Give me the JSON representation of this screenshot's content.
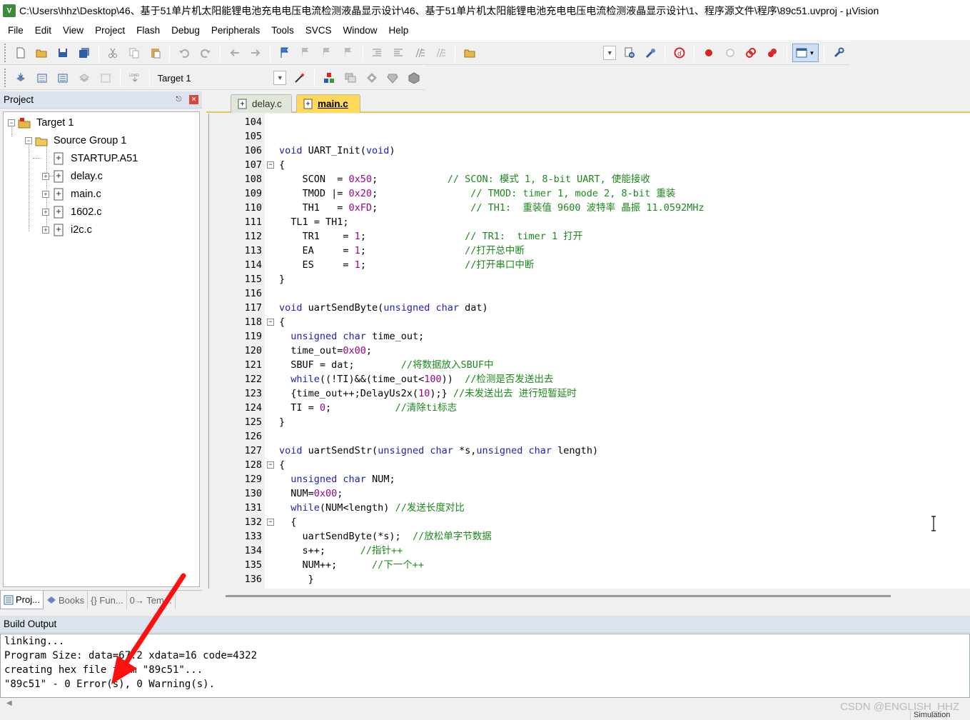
{
  "window": {
    "title": "C:\\Users\\hhz\\Desktop\\46、基于51单片机太阳能锂电池充电电压电流检测液晶显示设计\\46、基于51单片机太阳能锂电池充电电压电流检测液晶显示设计\\1、程序源文件\\程序\\89c51.uvproj - µVision",
    "logo": "V"
  },
  "menu": [
    "File",
    "Edit",
    "View",
    "Project",
    "Flash",
    "Debug",
    "Peripherals",
    "Tools",
    "SVCS",
    "Window",
    "Help"
  ],
  "toolbar2": {
    "target": "Target 1"
  },
  "project_panel": {
    "title": "Project",
    "tree": {
      "target": "Target 1",
      "group": "Source Group 1",
      "files": [
        "STARTUP.A51",
        "delay.c",
        "main.c",
        "1602.c",
        "i2c.c"
      ]
    },
    "bottom_tabs": [
      "Proj...",
      "Books",
      "{} Fun...",
      "0→ Tem..."
    ]
  },
  "editor": {
    "tabs": [
      "delay.c",
      "main.c"
    ],
    "active_tab": "main.c",
    "lines": [
      {
        "n": "104",
        "html": ""
      },
      {
        "n": "105",
        "html": ""
      },
      {
        "n": "106",
        "html": "<span class='kw'>void</span> UART_Init(<span class='kw'>void</span>)"
      },
      {
        "n": "107",
        "html": "{",
        "fold": "-"
      },
      {
        "n": "108",
        "html": "    SCON  = <span class='num'>0x50</span>;            <span class='cm'>// SCON: 模式 1, 8-bit UART, 使能接收</span>"
      },
      {
        "n": "109",
        "html": "    TMOD |= <span class='num'>0x20</span>;                <span class='cm'>// TMOD: timer 1, mode 2, 8-bit 重装</span>"
      },
      {
        "n": "110",
        "html": "    TH1   = <span class='num'>0xFD</span>;                <span class='cm'>// TH1:  重装值 9600 波特率 晶振 11.0592MHz</span>"
      },
      {
        "n": "111",
        "html": "  TL1 = TH1;"
      },
      {
        "n": "112",
        "html": "    TR1    = <span class='num'>1</span>;                 <span class='cm'>// TR1:  timer 1 打开</span>"
      },
      {
        "n": "113",
        "html": "    EA     = <span class='num'>1</span>;                 <span class='cm'>//打开总中断</span>"
      },
      {
        "n": "114",
        "html": "    ES     = <span class='num'>1</span>;                 <span class='cm'>//打开串口中断</span>"
      },
      {
        "n": "115",
        "html": "}"
      },
      {
        "n": "116",
        "html": ""
      },
      {
        "n": "117",
        "html": "<span class='kw'>void</span> uartSendByte(<span class='kw'>unsigned char</span> dat)"
      },
      {
        "n": "118",
        "html": "{",
        "fold": "-"
      },
      {
        "n": "119",
        "html": "  <span class='kw'>unsigned char</span> time_out;"
      },
      {
        "n": "120",
        "html": "  time_out=<span class='num'>0x00</span>;"
      },
      {
        "n": "121",
        "html": "  SBUF = dat;        <span class='cm'>//将数据放入SBUF中</span>"
      },
      {
        "n": "122",
        "html": "  <span class='kw'>while</span>((!TI)&&(time_out&lt;<span class='num'>100</span>))  <span class='cm'>//检测是否发送出去</span>"
      },
      {
        "n": "123",
        "html": "  {time_out++;DelayUs2x(<span class='num'>10</span>);} <span class='cm'>//未发送出去 进行短暂延时</span>"
      },
      {
        "n": "124",
        "html": "  TI = <span class='num'>0</span>;           <span class='cm'>//清除ti标志</span>"
      },
      {
        "n": "125",
        "html": "}"
      },
      {
        "n": "126",
        "html": ""
      },
      {
        "n": "127",
        "html": "<span class='kw'>void</span> uartSendStr(<span class='kw'>unsigned char</span> *s,<span class='kw'>unsigned char</span> length)"
      },
      {
        "n": "128",
        "html": "{",
        "fold": "-"
      },
      {
        "n": "129",
        "html": "  <span class='kw'>unsigned char</span> NUM;"
      },
      {
        "n": "130",
        "html": "  NUM=<span class='num'>0x00</span>;"
      },
      {
        "n": "131",
        "html": "  <span class='kw'>while</span>(NUM&lt;length) <span class='cm'>//发送长度对比</span>"
      },
      {
        "n": "132",
        "html": "  {",
        "fold": "-"
      },
      {
        "n": "133",
        "html": "    uartSendByte(*s);  <span class='cm'>//放松单字节数据</span>"
      },
      {
        "n": "134",
        "html": "    s++;      <span class='cm'>//指针++</span>"
      },
      {
        "n": "135",
        "html": "    NUM++;      <span class='cm'>//下一个++</span>"
      },
      {
        "n": "136",
        "html": "     }"
      }
    ]
  },
  "build": {
    "title": "Build Output",
    "lines": [
      "linking...",
      "Program Size: data=67.2 xdata=16 code=4322",
      "creating hex file from \"89c51\"...",
      "\"89c51\" - 0 Error(s), 0 Warning(s)."
    ]
  },
  "status": {
    "mode": "Simulation"
  },
  "watermark": "CSDN @ENGLISH_HHZ"
}
